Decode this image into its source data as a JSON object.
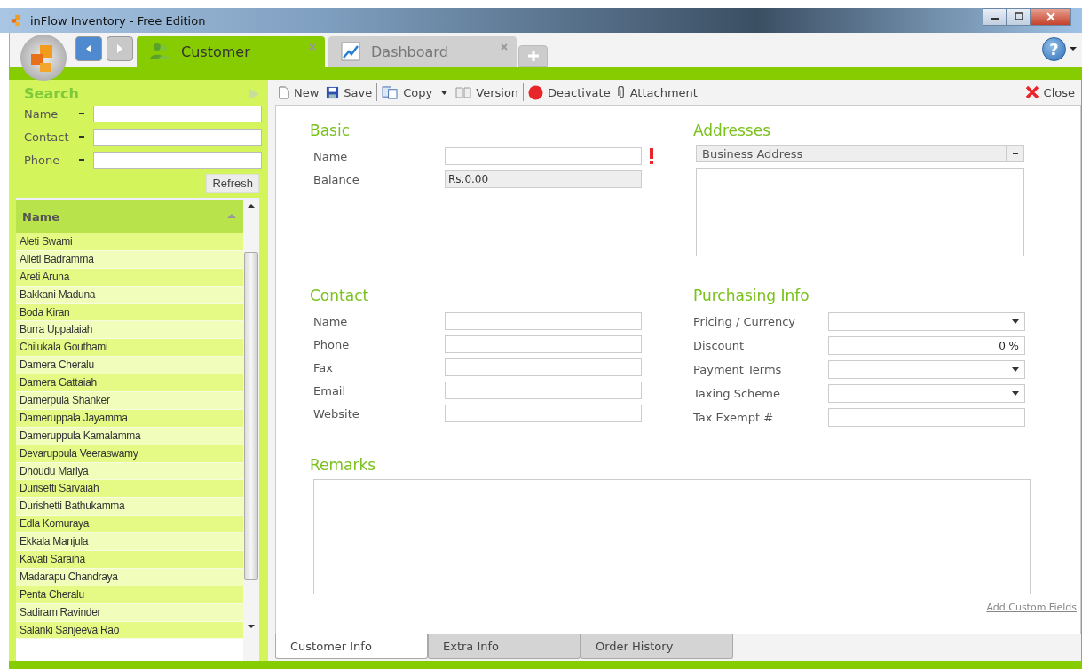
{
  "window": {
    "title": "inFlow Inventory - Free Edition"
  },
  "tabs": [
    {
      "label": "Customer",
      "kind": "customer",
      "selected": true
    },
    {
      "label": "Dashboard",
      "kind": "dashboard",
      "selected": false
    }
  ],
  "search": {
    "title": "Search",
    "fields": [
      {
        "label": "Name"
      },
      {
        "label": "Contact"
      },
      {
        "label": "Phone"
      }
    ],
    "button": "Refresh"
  },
  "customer_list": {
    "column": "Name",
    "rows": [
      "Aleti Swami",
      "Alleti Badramma",
      "Areti Aruna",
      "Bakkani Maduna",
      "Boda Kiran",
      "Burra Uppalaiah",
      "Chilukala Gouthami",
      "Damera Cheralu",
      "Damera Gattaiah",
      "Damerpula Shanker",
      "Dameruppala Jayamma",
      "Dameruppula Kamalamma",
      "Devaruppula Veeraswamy",
      "Dhoudu Mariya",
      "Durisetti Sarvaiah",
      "Durishetti Bathukamma",
      "Edla Komuraya",
      "Ekkala Manjula",
      "Kavati Saraiha",
      "Madarapu Chandraya",
      "Penta Cheralu",
      "Sadiram Ravinder",
      "Salanki Sanjeeva Rao"
    ]
  },
  "toolbar": [
    {
      "label": "New",
      "kind": "new"
    },
    {
      "label": "Save",
      "kind": "save"
    },
    {
      "label": "Copy",
      "kind": "copy"
    },
    {
      "label": "Version",
      "kind": "version"
    },
    {
      "label": "Deactivate",
      "kind": "deactivate"
    },
    {
      "label": "Attachment",
      "kind": "attachment"
    }
  ],
  "close": "Close",
  "help": "?",
  "basic": {
    "title": "Basic",
    "fields": [
      {
        "label": "Name",
        "kind": "text",
        "required": true
      },
      {
        "label": "Balance",
        "kind": "readonly",
        "value": "Rs.0.00",
        "required": false
      }
    ]
  },
  "addresses": {
    "title": "Addresses",
    "address_type": "Business Address"
  },
  "contact": {
    "title": "Contact",
    "fields": [
      {
        "label": "Name"
      },
      {
        "label": "Phone"
      },
      {
        "label": "Fax"
      },
      {
        "label": "Email"
      },
      {
        "label": "Website"
      }
    ]
  },
  "purchasing": {
    "title": "Purchasing Info",
    "fields": [
      {
        "label": "Pricing / Currency",
        "kind": "select"
      },
      {
        "label": "Discount",
        "kind": "text",
        "value": "0 %"
      },
      {
        "label": "Payment Terms",
        "kind": "select"
      },
      {
        "label": "Taxing Scheme",
        "kind": "select"
      },
      {
        "label": "Tax Exempt #",
        "kind": "text"
      }
    ]
  },
  "remarks": {
    "title": "Remarks"
  },
  "add_custom_fields": "Add Custom Fields",
  "bottom_tabs": [
    {
      "label": "Customer Info",
      "selected": true
    },
    {
      "label": "Extra Info",
      "selected": false
    },
    {
      "label": "Order History",
      "selected": false
    }
  ]
}
